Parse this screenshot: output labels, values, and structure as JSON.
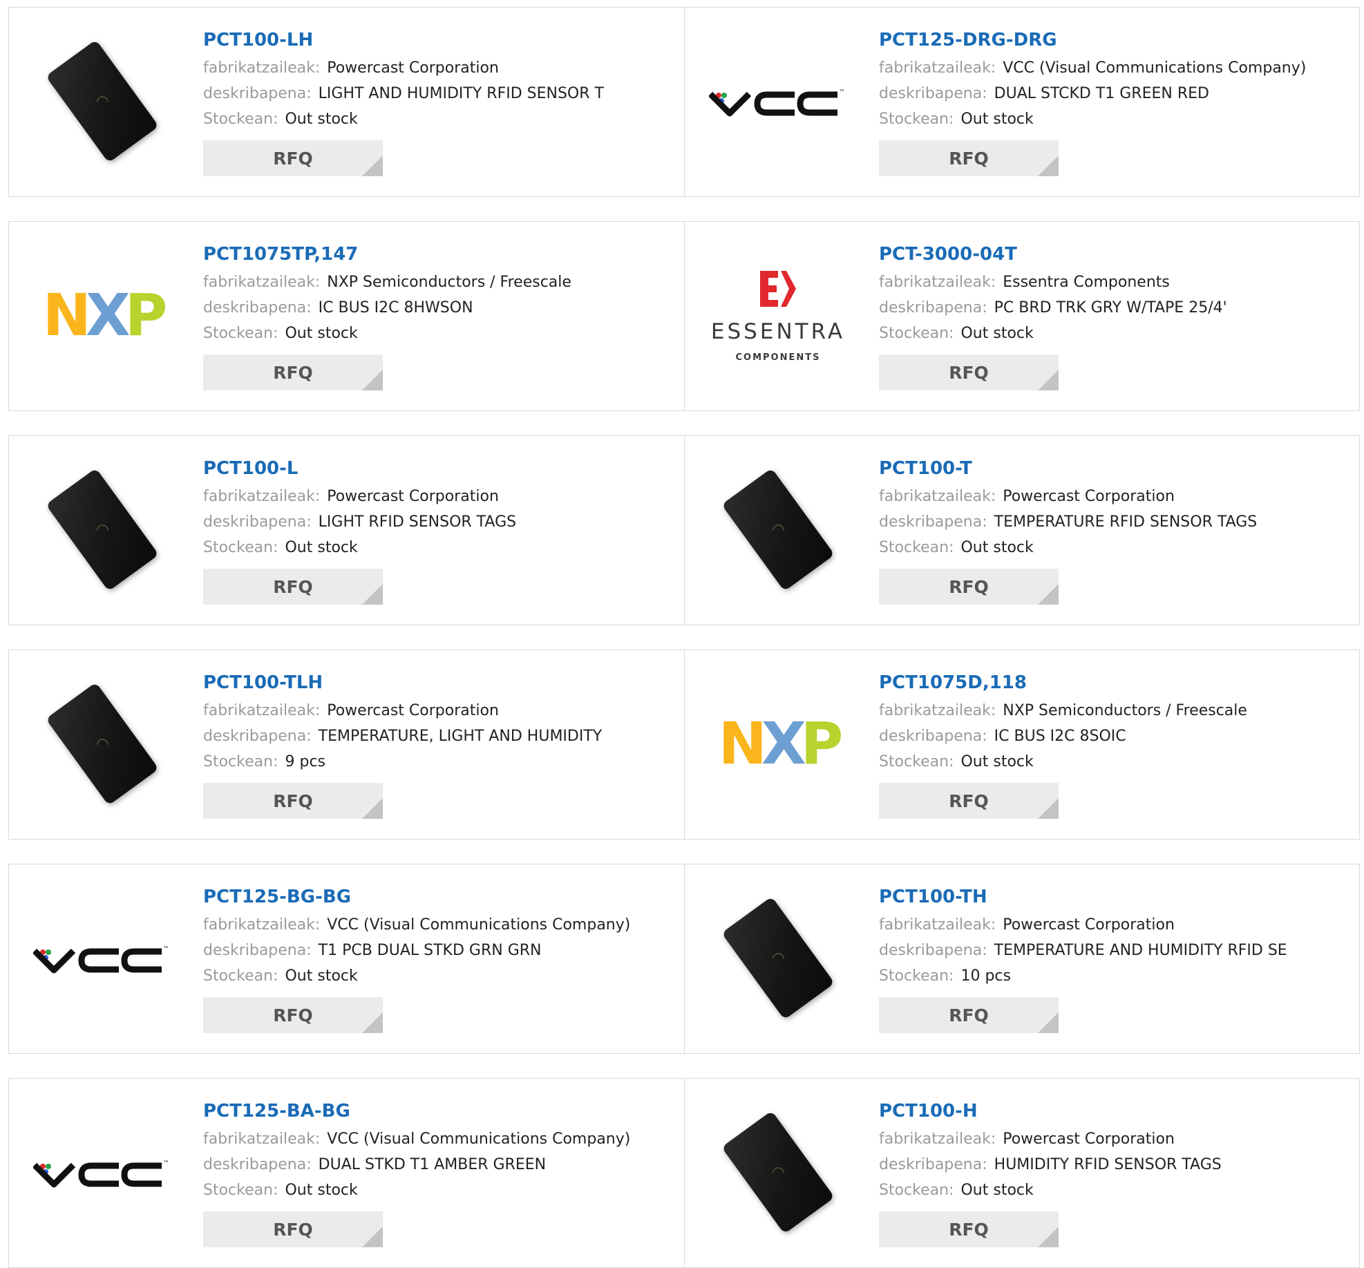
{
  "labels": {
    "manufacturer": "fabrikatzaileak:",
    "description": "deskribapena:",
    "stock": "Stockean:",
    "rfq": "RFQ"
  },
  "products": [
    {
      "part": "PCT100-LH",
      "manufacturer": "Powercast Corporation",
      "description": "LIGHT AND HUMIDITY RFID SENSOR T",
      "stock": "Out stock",
      "image": "rfid-tag"
    },
    {
      "part": "PCT125-DRG-DRG",
      "manufacturer": "VCC (Visual Communications Company)",
      "description": "DUAL STCKD T1 GREEN RED",
      "stock": "Out stock",
      "image": "vcc-logo"
    },
    {
      "part": "PCT1075TP,147",
      "manufacturer": "NXP Semiconductors / Freescale",
      "description": "IC BUS I2C 8HWSON",
      "stock": "Out stock",
      "image": "nxp-logo"
    },
    {
      "part": "PCT-3000-04T",
      "manufacturer": "Essentra Components",
      "description": "PC BRD TRK GRY W/TAPE 25/4'",
      "stock": "Out stock",
      "image": "essentra-logo"
    },
    {
      "part": "PCT100-L",
      "manufacturer": "Powercast Corporation",
      "description": "LIGHT RFID SENSOR TAGS",
      "stock": "Out stock",
      "image": "rfid-tag"
    },
    {
      "part": "PCT100-T",
      "manufacturer": "Powercast Corporation",
      "description": "TEMPERATURE RFID SENSOR TAGS",
      "stock": "Out stock",
      "image": "rfid-tag"
    },
    {
      "part": "PCT100-TLH",
      "manufacturer": "Powercast Corporation",
      "description": "TEMPERATURE, LIGHT AND HUMIDITY",
      "stock": "9 pcs",
      "image": "rfid-tag"
    },
    {
      "part": "PCT1075D,118",
      "manufacturer": "NXP Semiconductors / Freescale",
      "description": "IC BUS I2C 8SOIC",
      "stock": "Out stock",
      "image": "nxp-logo"
    },
    {
      "part": "PCT125-BG-BG",
      "manufacturer": "VCC (Visual Communications Company)",
      "description": "T1 PCB DUAL STKD GRN GRN",
      "stock": "Out stock",
      "image": "vcc-logo"
    },
    {
      "part": "PCT100-TH",
      "manufacturer": "Powercast Corporation",
      "description": "TEMPERATURE AND HUMIDITY RFID SE",
      "stock": "10 pcs",
      "image": "rfid-tag"
    },
    {
      "part": "PCT125-BA-BG",
      "manufacturer": "VCC (Visual Communications Company)",
      "description": "DUAL STKD T1 AMBER GREEN",
      "stock": "Out stock",
      "image": "vcc-logo"
    },
    {
      "part": "PCT100-H",
      "manufacturer": "Powercast Corporation",
      "description": "HUMIDITY RFID SENSOR TAGS",
      "stock": "Out stock",
      "image": "rfid-tag"
    }
  ],
  "logos": {
    "vcc": {
      "text": "VCC",
      "tm": "™"
    },
    "nxp": {
      "letters": [
        "N",
        "X",
        "P"
      ],
      "colors": [
        "#f9b51b",
        "#6d9fd3",
        "#b9d22d"
      ]
    },
    "essentra": {
      "mark": "E",
      "word": "ESSENTRA",
      "sub": "COMPONENTS",
      "color": "#e0282d"
    }
  },
  "colors": {
    "link": "#1a6bb6",
    "label": "#9a9a9a",
    "button_bg": "#ebebeb"
  }
}
